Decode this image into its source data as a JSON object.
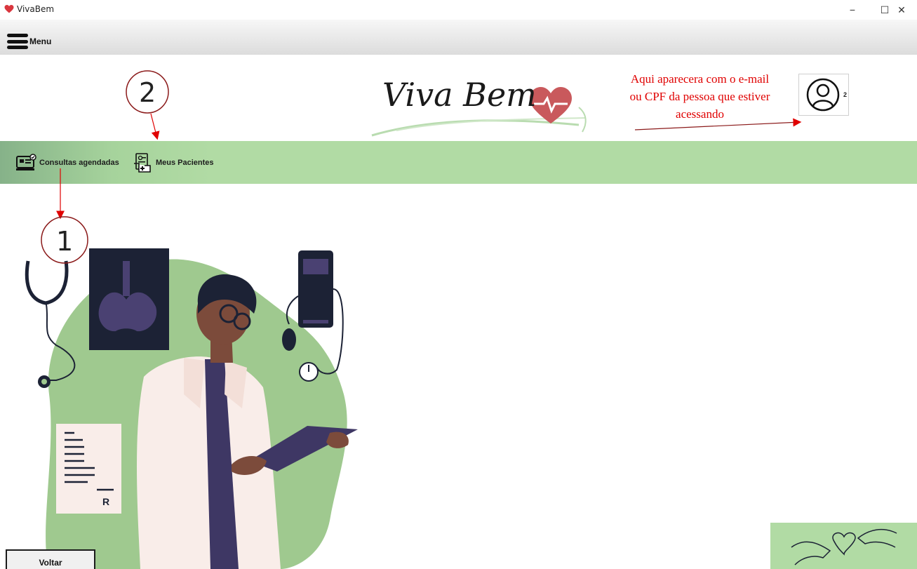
{
  "window": {
    "title": "VivaBem",
    "minimize_glyph": "−",
    "maximize_glyph": "☐",
    "close_glyph": "✕"
  },
  "menubar": {
    "menu_label": "Menu"
  },
  "header": {
    "logo_text": "Viva Bem",
    "annotation_lines": [
      "Aqui aparecera com o e-mail",
      "ou CPF da pessoa que estiver",
      "acessando"
    ],
    "avatar_number": "2"
  },
  "nav": {
    "items": [
      {
        "label": "Consultas agendadas",
        "icon": "calendar-monitor-icon"
      },
      {
        "label": "Meus Pacientes",
        "icon": "patient-file-icon"
      }
    ]
  },
  "annotations": {
    "markers": [
      "1",
      "2"
    ]
  },
  "footer": {
    "voltar_label": "Voltar"
  },
  "colors": {
    "nav_green": "#b1dba4",
    "nav_green_dark": "#86b289",
    "blob_green": "#9fc98f",
    "annotation_red": "#e00000",
    "marker_circle": "#8b1a1a",
    "heart": "#c9595c"
  }
}
